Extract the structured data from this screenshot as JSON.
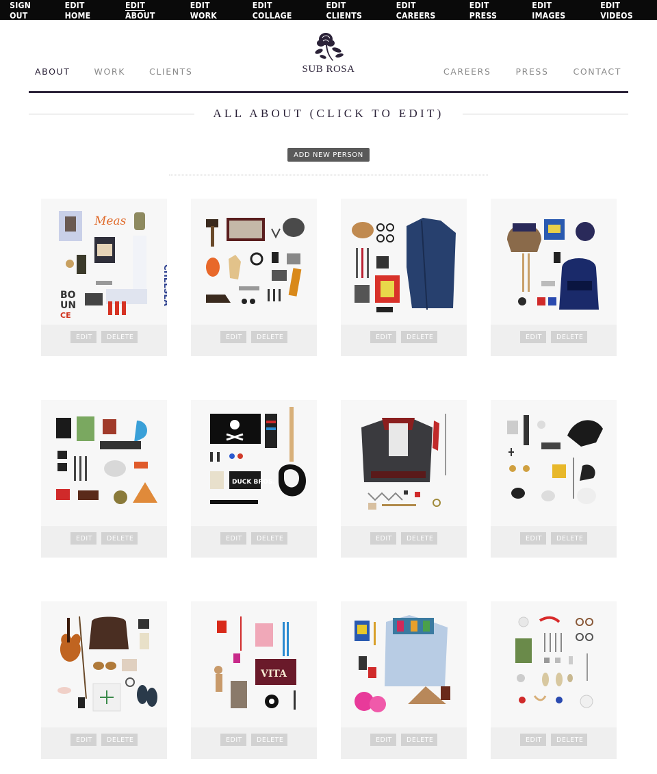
{
  "admin_bar": {
    "items": [
      "SIGN OUT",
      "EDIT HOME",
      "EDIT ABOUT",
      "EDIT WORK",
      "EDIT COLLAGE",
      "EDIT CLIENTS",
      "EDIT CAREERS",
      "EDIT PRESS",
      "EDIT IMAGES",
      "EDIT VIDEOS"
    ],
    "active_index": 2
  },
  "nav": {
    "left": [
      "ABOUT",
      "WORK",
      "CLIENTS"
    ],
    "right": [
      "CAREERS",
      "PRESS",
      "CONTACT"
    ],
    "current": "ABOUT"
  },
  "logo": {
    "text": "SUB ROSA",
    "icon": "rose-icon"
  },
  "section": {
    "title": "ALL ABOUT (CLICK TO EDIT)"
  },
  "add_button": {
    "label": "ADD NEW PERSON"
  },
  "cards": [
    {
      "edit": "EDIT",
      "delete": "DELETE"
    },
    {
      "edit": "EDIT",
      "delete": "DELETE"
    },
    {
      "edit": "EDIT",
      "delete": "DELETE"
    },
    {
      "edit": "EDIT",
      "delete": "DELETE"
    },
    {
      "edit": "EDIT",
      "delete": "DELETE"
    },
    {
      "edit": "EDIT",
      "delete": "DELETE"
    },
    {
      "edit": "EDIT",
      "delete": "DELETE"
    },
    {
      "edit": "EDIT",
      "delete": "DELETE"
    },
    {
      "edit": "EDIT",
      "delete": "DELETE"
    },
    {
      "edit": "EDIT",
      "delete": "DELETE"
    },
    {
      "edit": "EDIT",
      "delete": "DELETE"
    },
    {
      "edit": "EDIT",
      "delete": "DELETE"
    }
  ],
  "colors": {
    "brand": "#2b2238",
    "admin_bg": "#0a0a0a",
    "card_bg": "#efefef",
    "button_bg": "#5a5a5a"
  }
}
